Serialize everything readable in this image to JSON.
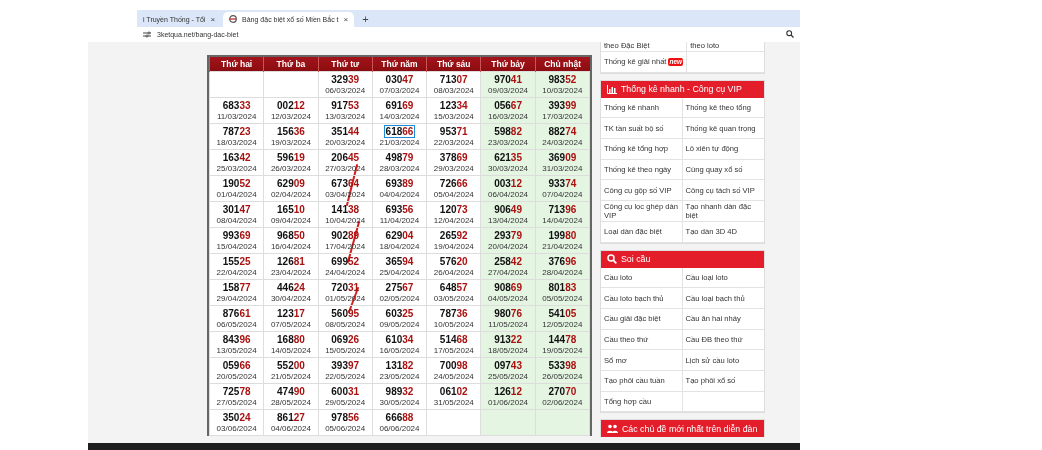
{
  "browser": {
    "tabs": [
      {
        "title": "i Truyền Thống - Tổi",
        "close": "×",
        "selected": false
      },
      {
        "title": "Bảng đặc biệt xổ số Miền Bắc t",
        "close": "×",
        "selected": true
      }
    ],
    "new_tab": "+",
    "address": "3ketqua.net/bang-dac-biet"
  },
  "table": {
    "columns": [
      {
        "label": "Thứ hai",
        "shaded": false
      },
      {
        "label": "Thứ ba",
        "shaded": false
      },
      {
        "label": "Thứ tư",
        "shaded": false
      },
      {
        "label": "Thứ năm",
        "shaded": false
      },
      {
        "label": "Thứ sáu",
        "shaded": false
      },
      {
        "label": "Thứ bảy",
        "shaded": true
      },
      {
        "label": "Chủ nhật",
        "shaded": true
      }
    ],
    "rows": [
      [
        null,
        null,
        {
          "number": "32939",
          "date": "06/03/2024",
          "selected": false
        },
        {
          "number": "03047",
          "date": "07/03/2024",
          "selected": false
        },
        {
          "number": "71307",
          "date": "08/03/2024",
          "selected": false
        },
        {
          "number": "97041",
          "date": "09/03/2024",
          "selected": false
        },
        {
          "number": "98352",
          "date": "10/03/2024",
          "selected": false
        }
      ],
      [
        {
          "number": "68333",
          "date": "11/03/2024",
          "selected": false
        },
        {
          "number": "00212",
          "date": "12/03/2024",
          "selected": false
        },
        {
          "number": "91753",
          "date": "13/03/2024",
          "selected": false
        },
        {
          "number": "69169",
          "date": "14/03/2024",
          "selected": false
        },
        {
          "number": "12334",
          "date": "15/03/2024",
          "selected": false
        },
        {
          "number": "05667",
          "date": "16/03/2024",
          "selected": false
        },
        {
          "number": "39399",
          "date": "17/03/2024",
          "selected": false
        }
      ],
      [
        {
          "number": "78723",
          "date": "18/03/2024",
          "selected": false
        },
        {
          "number": "15636",
          "date": "19/03/2024",
          "selected": false
        },
        {
          "number": "35144",
          "date": "20/03/2024",
          "selected": false
        },
        {
          "number": "61866",
          "date": "21/03/2024",
          "selected": true
        },
        {
          "number": "95371",
          "date": "22/03/2024",
          "selected": false
        },
        {
          "number": "59882",
          "date": "23/03/2024",
          "selected": false
        },
        {
          "number": "88274",
          "date": "24/03/2024",
          "selected": false
        }
      ],
      [
        {
          "number": "16342",
          "date": "25/03/2024",
          "selected": false
        },
        {
          "number": "59619",
          "date": "26/03/2024",
          "selected": false
        },
        {
          "number": "20645",
          "date": "27/03/2024",
          "selected": false
        },
        {
          "number": "49879",
          "date": "28/03/2024",
          "selected": false
        },
        {
          "number": "37869",
          "date": "29/03/2024",
          "selected": false
        },
        {
          "number": "62135",
          "date": "30/03/2024",
          "selected": false
        },
        {
          "number": "36909",
          "date": "31/03/2024",
          "selected": false
        }
      ],
      [
        {
          "number": "19052",
          "date": "01/04/2024",
          "selected": false
        },
        {
          "number": "62909",
          "date": "02/04/2024",
          "selected": false
        },
        {
          "number": "67364",
          "date": "03/04/2024",
          "selected": false
        },
        {
          "number": "69389",
          "date": "04/04/2024",
          "selected": false
        },
        {
          "number": "72666",
          "date": "05/04/2024",
          "selected": false
        },
        {
          "number": "00312",
          "date": "06/04/2024",
          "selected": false
        },
        {
          "number": "93374",
          "date": "07/04/2024",
          "selected": false
        }
      ],
      [
        {
          "number": "30147",
          "date": "08/04/2024",
          "selected": false
        },
        {
          "number": "16510",
          "date": "09/04/2024",
          "selected": false
        },
        {
          "number": "14138",
          "date": "10/04/2024",
          "selected": false
        },
        {
          "number": "69356",
          "date": "11/04/2024",
          "selected": false
        },
        {
          "number": "12073",
          "date": "12/04/2024",
          "selected": false
        },
        {
          "number": "90649",
          "date": "13/04/2024",
          "selected": false
        },
        {
          "number": "71396",
          "date": "14/04/2024",
          "selected": false
        }
      ],
      [
        {
          "number": "99369",
          "date": "15/04/2024",
          "selected": false
        },
        {
          "number": "96850",
          "date": "16/04/2024",
          "selected": false
        },
        {
          "number": "90289",
          "date": "17/04/2024",
          "selected": false
        },
        {
          "number": "62904",
          "date": "18/04/2024",
          "selected": false
        },
        {
          "number": "26592",
          "date": "19/04/2024",
          "selected": false
        },
        {
          "number": "29379",
          "date": "20/04/2024",
          "selected": false
        },
        {
          "number": "19980",
          "date": "21/04/2024",
          "selected": false
        }
      ],
      [
        {
          "number": "15525",
          "date": "22/04/2024",
          "selected": false
        },
        {
          "number": "12681",
          "date": "23/04/2024",
          "selected": false
        },
        {
          "number": "69952",
          "date": "24/04/2024",
          "selected": false
        },
        {
          "number": "36594",
          "date": "25/04/2024",
          "selected": false
        },
        {
          "number": "57620",
          "date": "26/04/2024",
          "selected": false
        },
        {
          "number": "25842",
          "date": "27/04/2024",
          "selected": false
        },
        {
          "number": "37696",
          "date": "28/04/2024",
          "selected": false
        }
      ],
      [
        {
          "number": "15877",
          "date": "29/04/2024",
          "selected": false
        },
        {
          "number": "44624",
          "date": "30/04/2024",
          "selected": false
        },
        {
          "number": "72031",
          "date": "01/05/2024",
          "selected": false
        },
        {
          "number": "27567",
          "date": "02/05/2024",
          "selected": false
        },
        {
          "number": "64857",
          "date": "03/05/2024",
          "selected": false
        },
        {
          "number": "90869",
          "date": "04/05/2024",
          "selected": false
        },
        {
          "number": "80183",
          "date": "05/05/2024",
          "selected": false
        }
      ],
      [
        {
          "number": "87661",
          "date": "06/05/2024",
          "selected": false
        },
        {
          "number": "12317",
          "date": "07/05/2024",
          "selected": false
        },
        {
          "number": "56095",
          "date": "08/05/2024",
          "selected": false
        },
        {
          "number": "60325",
          "date": "09/05/2024",
          "selected": false
        },
        {
          "number": "78736",
          "date": "10/05/2024",
          "selected": false
        },
        {
          "number": "98076",
          "date": "11/05/2024",
          "selected": false
        },
        {
          "number": "54105",
          "date": "12/05/2024",
          "selected": false
        }
      ],
      [
        {
          "number": "84396",
          "date": "13/05/2024",
          "selected": false
        },
        {
          "number": "16880",
          "date": "14/05/2024",
          "selected": false
        },
        {
          "number": "06926",
          "date": "15/05/2024",
          "selected": false
        },
        {
          "number": "61034",
          "date": "16/05/2024",
          "selected": false
        },
        {
          "number": "51468",
          "date": "17/05/2024",
          "selected": false
        },
        {
          "number": "91322",
          "date": "18/05/2024",
          "selected": false
        },
        {
          "number": "14478",
          "date": "19/05/2024",
          "selected": false
        }
      ],
      [
        {
          "number": "05966",
          "date": "20/05/2024",
          "selected": false
        },
        {
          "number": "55200",
          "date": "21/05/2024",
          "selected": false
        },
        {
          "number": "39397",
          "date": "22/05/2024",
          "selected": false
        },
        {
          "number": "13182",
          "date": "23/05/2024",
          "selected": false
        },
        {
          "number": "70098",
          "date": "24/05/2024",
          "selected": false
        },
        {
          "number": "09743",
          "date": "25/05/2024",
          "selected": false
        },
        {
          "number": "53398",
          "date": "26/05/2024",
          "selected": false
        }
      ],
      [
        {
          "number": "72578",
          "date": "27/05/2024",
          "selected": false
        },
        {
          "number": "47490",
          "date": "28/05/2024",
          "selected": false
        },
        {
          "number": "60031",
          "date": "29/05/2024",
          "selected": false
        },
        {
          "number": "98932",
          "date": "30/05/2024",
          "selected": false
        },
        {
          "number": "06102",
          "date": "31/05/2024",
          "selected": false
        },
        {
          "number": "12612",
          "date": "01/06/2024",
          "selected": false
        },
        {
          "number": "27070",
          "date": "02/06/2024",
          "selected": false
        }
      ],
      [
        {
          "number": "35024",
          "date": "03/06/2024",
          "selected": false
        },
        {
          "number": "86127",
          "date": "04/06/2024",
          "selected": false
        },
        {
          "number": "97856",
          "date": "05/06/2024",
          "selected": false
        },
        {
          "number": "66688",
          "date": "06/06/2024",
          "selected": false
        },
        null,
        null,
        null
      ]
    ]
  },
  "sidebar": {
    "partial_links": [
      {
        "label": "theo Đặc Biệt"
      },
      {
        "label": "theo loto"
      },
      {
        "label": "Thống kê giải nhất",
        "badge": "new"
      }
    ],
    "sections": [
      {
        "title": "Thống kê nhanh - Công cụ VIP",
        "kind": "chart",
        "links": [
          "Thống kê nhanh",
          "Thống kê theo tổng",
          "TK tần suất bộ số",
          "Thống kê quan trọng",
          "Thống kê tổng hợp",
          "Lô xiên tự động",
          "Thống kê theo ngày",
          "Cùng quay xổ số",
          "Công cụ gộp số VIP",
          "Công cụ tách số VIP",
          "Công cụ lọc ghép dàn VIP",
          "Tạo nhanh dàn đặc biệt",
          "Loại dàn đặc biệt",
          "Tạo dàn 3D 4D"
        ]
      },
      {
        "title": "Soi cầu",
        "kind": "search",
        "links": [
          "Cầu loto",
          "Cầu loại loto",
          "Cầu loto bạch thủ",
          "Cầu loại bạch thủ",
          "Cầu giải đặc biệt",
          "Cầu ăn hai nháy",
          "Cầu theo thứ",
          "Cầu ĐB theo thứ",
          "Sổ mơ",
          "Lịch sử cầu loto",
          "Tạo phôi cầu tuần",
          "Tạo phôi xổ số",
          "Tổng hợp cầu"
        ]
      },
      {
        "title": "Các chủ đề mới nhất trên diễn đàn",
        "kind": "users"
      }
    ]
  }
}
